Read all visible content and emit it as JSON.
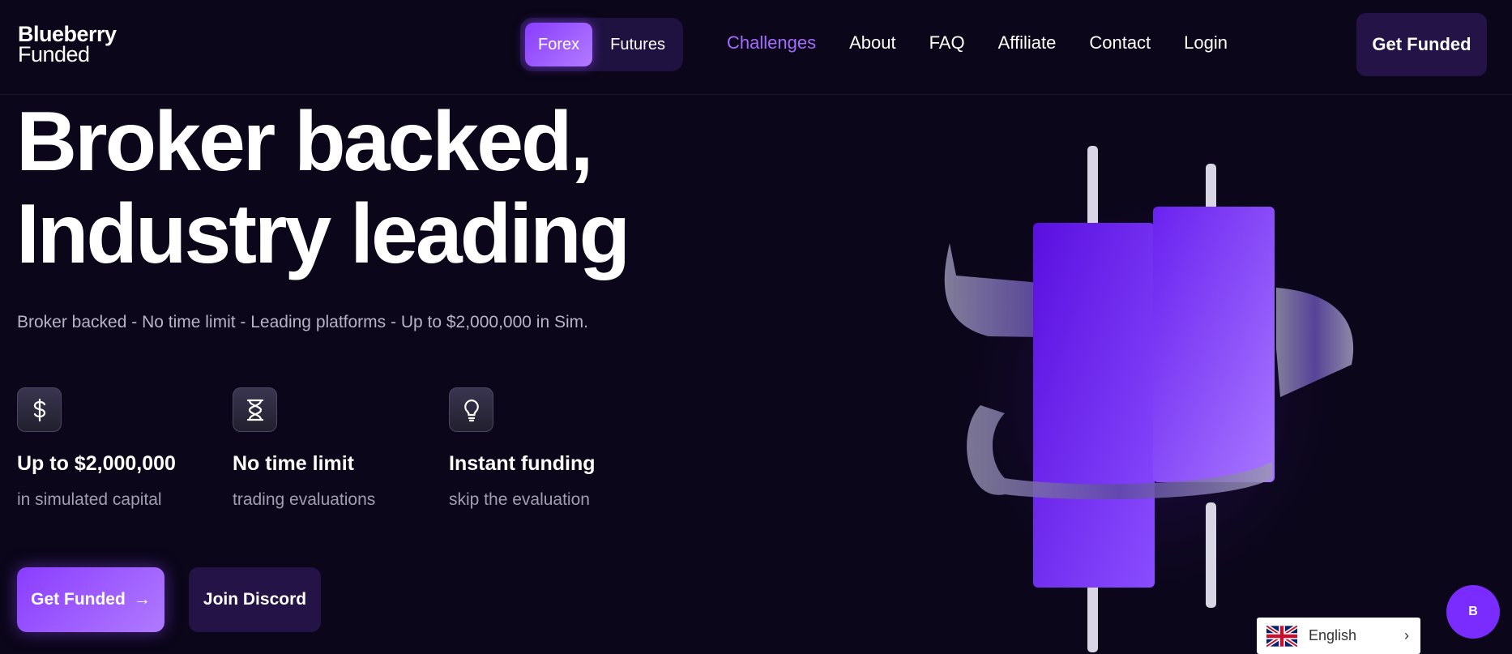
{
  "nav": {
    "logo_line1": "Blueberry",
    "logo_line2": "Funded",
    "switch": {
      "active": "Forex",
      "inactive": "Futures"
    },
    "links": [
      "Challenges",
      "About",
      "FAQ",
      "Affiliate",
      "Contact",
      "Login"
    ],
    "cta": "Get Funded"
  },
  "hero": {
    "headline_line1": "Broker backed,",
    "headline_line2": "Industry leading",
    "subtitle": "Broker backed - No time limit - Leading platforms - Up to $2,000,000 in Sim."
  },
  "features": [
    {
      "icon": "dollar-icon",
      "title": "Up to $2,000,000",
      "desc": "in simulated capital"
    },
    {
      "icon": "hourglass-icon",
      "title": "No time limit",
      "desc": "trading evaluations"
    },
    {
      "icon": "lightbulb-icon",
      "title": "Instant funding",
      "desc": "skip the evaluation"
    }
  ],
  "buttons": {
    "primary": "Get Funded",
    "primary_arrow": "→",
    "secondary": "Join Discord"
  },
  "language": {
    "label": "English",
    "chevron": "›"
  },
  "chat": {
    "label": "B"
  },
  "colors": {
    "bg": "#0b0619",
    "accent": "#8a3dff",
    "accent_text": "#a36cff",
    "dark_btn": "#241346"
  }
}
